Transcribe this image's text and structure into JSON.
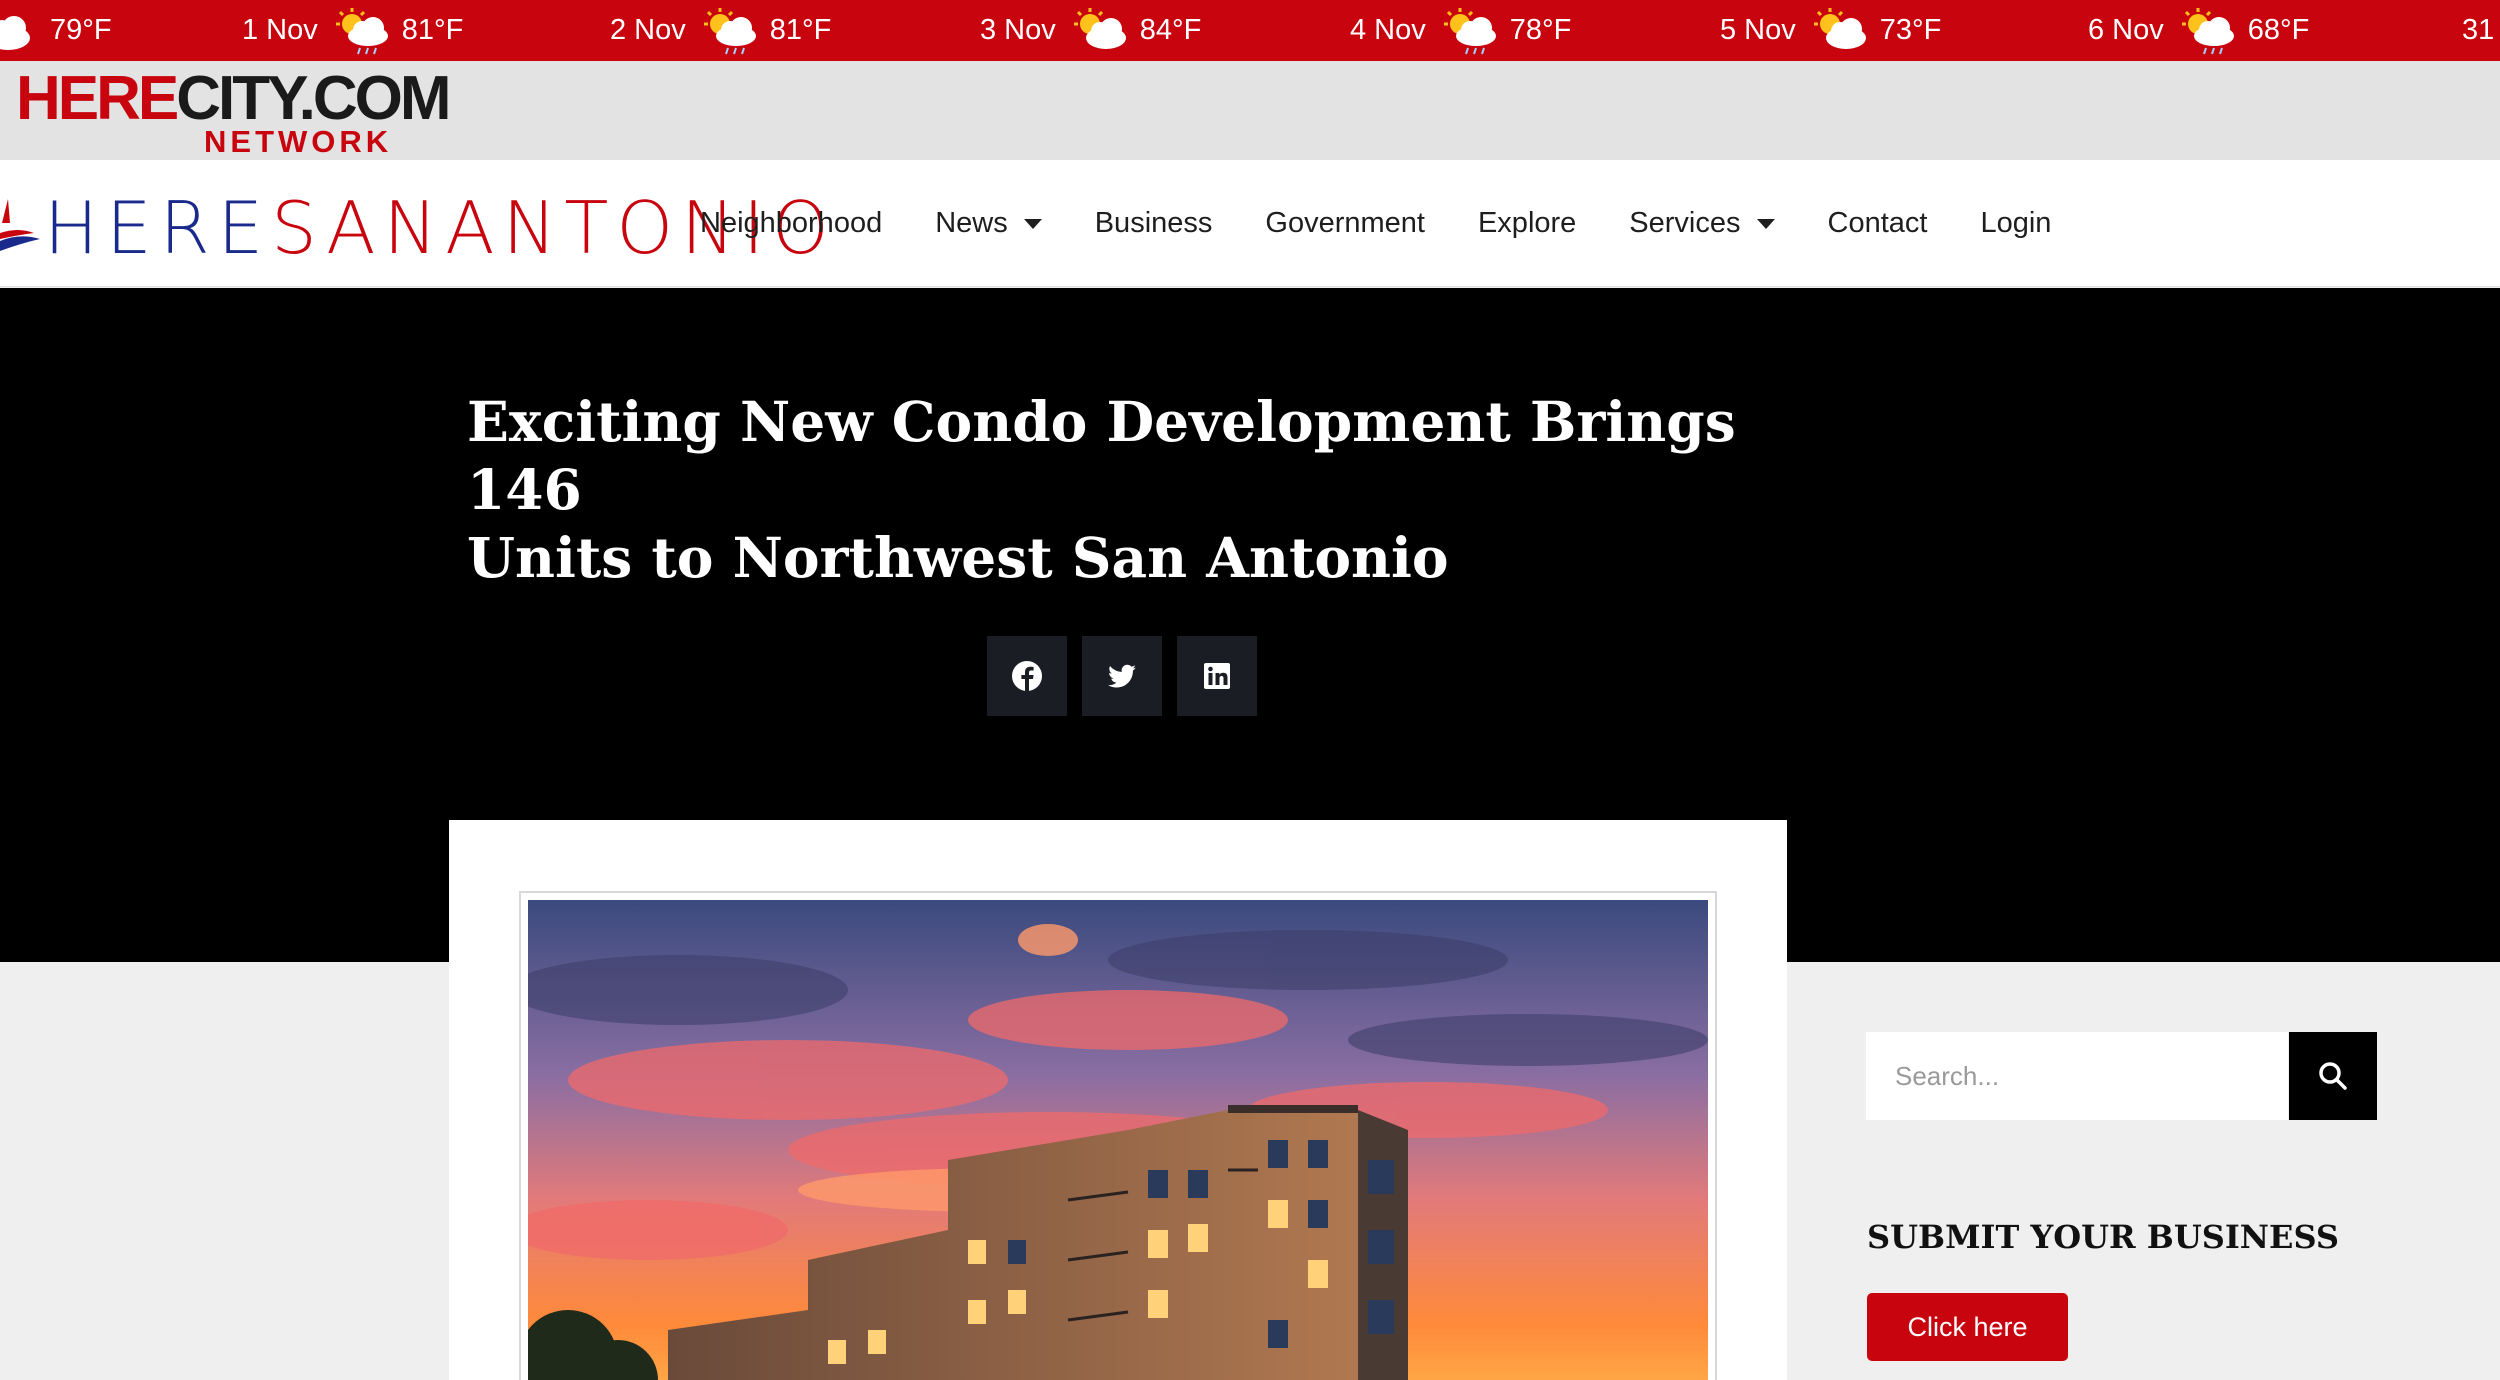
{
  "weather_ticker": [
    {
      "date": "",
      "temp": "79°F",
      "icon": "cloud-icon"
    },
    {
      "date": "1 Nov",
      "temp": "81°F",
      "icon": "sun-cloud-rain-icon"
    },
    {
      "date": "2 Nov",
      "temp": "81°F",
      "icon": "sun-cloud-rain-icon"
    },
    {
      "date": "3 Nov",
      "temp": "84°F",
      "icon": "sun-cloud-icon"
    },
    {
      "date": "4 Nov",
      "temp": "78°F",
      "icon": "sun-cloud-rain-icon"
    },
    {
      "date": "5 Nov",
      "temp": "73°F",
      "icon": "sun-cloud-icon"
    },
    {
      "date": "6 Nov",
      "temp": "68°F",
      "icon": "sun-cloud-rain-icon"
    },
    {
      "date": "31",
      "temp": "",
      "icon": ""
    }
  ],
  "network_logo": {
    "name": "HERECITY.COM",
    "part1": "HERE",
    "part2": "CITY.COM",
    "sub": "NETWORK"
  },
  "site_logo": {
    "part1": "HERE",
    "part2": "SANANTONIO"
  },
  "nav": {
    "items": [
      {
        "label": "Neighborhood",
        "dropdown": false
      },
      {
        "label": "News",
        "dropdown": true
      },
      {
        "label": "Business",
        "dropdown": false
      },
      {
        "label": "Government",
        "dropdown": false
      },
      {
        "label": "Explore",
        "dropdown": false
      },
      {
        "label": "Services",
        "dropdown": true
      },
      {
        "label": "Contact",
        "dropdown": false
      },
      {
        "label": "Login",
        "dropdown": false
      }
    ]
  },
  "article": {
    "headline_line1": "Exciting New Condo Development Brings 146",
    "headline_line2": "Units to Northwest San Antonio"
  },
  "share": [
    {
      "icon": "facebook-icon"
    },
    {
      "icon": "twitter-icon"
    },
    {
      "icon": "linkedin-icon"
    }
  ],
  "sidebar": {
    "search_placeholder": "Search...",
    "heading": "SUBMIT YOUR BUSINESS",
    "cta_label": "Click here"
  },
  "colors": {
    "brand_red": "#c8040e",
    "brand_blue": "#1a2a8c",
    "hero_bg": "#000000",
    "share_bg": "#1a1e24"
  }
}
